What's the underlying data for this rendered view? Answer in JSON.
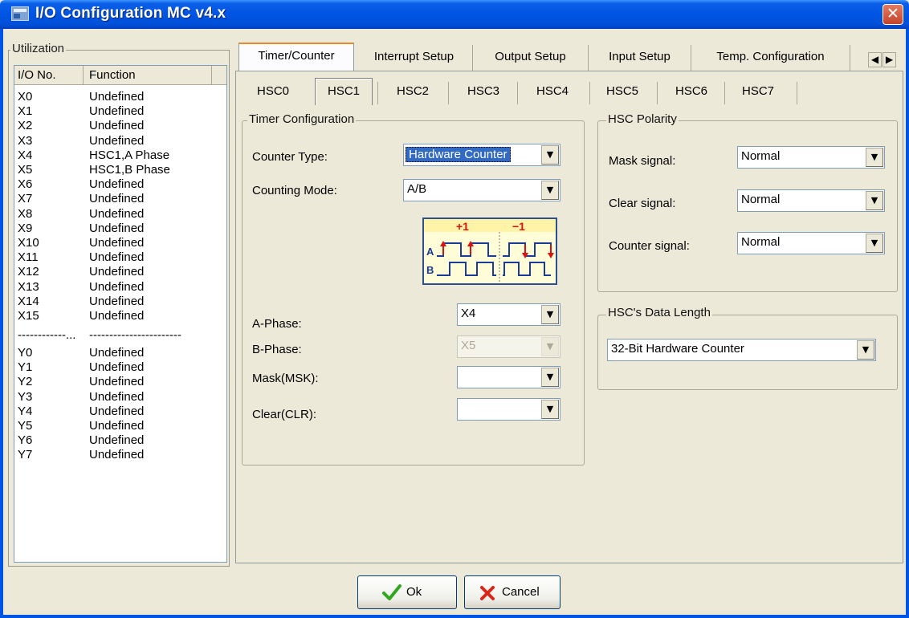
{
  "window": {
    "title": "I/O Configuration MC v4.x",
    "close_glyph": "✕"
  },
  "utilization": {
    "legend": "Utilization",
    "headers": [
      "I/O No.",
      "Function"
    ],
    "inputs": [
      {
        "io": "X0",
        "fn": "Undefined"
      },
      {
        "io": "X1",
        "fn": "Undefined"
      },
      {
        "io": "X2",
        "fn": "Undefined"
      },
      {
        "io": "X3",
        "fn": "Undefined"
      },
      {
        "io": "X4",
        "fn": "HSC1,A Phase"
      },
      {
        "io": "X5",
        "fn": "HSC1,B Phase"
      },
      {
        "io": "X6",
        "fn": "Undefined"
      },
      {
        "io": "X7",
        "fn": "Undefined"
      },
      {
        "io": "X8",
        "fn": "Undefined"
      },
      {
        "io": "X9",
        "fn": "Undefined"
      },
      {
        "io": "X10",
        "fn": "Undefined"
      },
      {
        "io": "X11",
        "fn": "Undefined"
      },
      {
        "io": "X12",
        "fn": "Undefined"
      },
      {
        "io": "X13",
        "fn": "Undefined"
      },
      {
        "io": "X14",
        "fn": "Undefined"
      },
      {
        "io": "X15",
        "fn": "Undefined"
      }
    ],
    "separator": {
      "io": "------------...",
      "fn": "-----------------------"
    },
    "outputs": [
      {
        "io": "Y0",
        "fn": "Undefined"
      },
      {
        "io": "Y1",
        "fn": "Undefined"
      },
      {
        "io": "Y2",
        "fn": "Undefined"
      },
      {
        "io": "Y3",
        "fn": "Undefined"
      },
      {
        "io": "Y4",
        "fn": "Undefined"
      },
      {
        "io": "Y5",
        "fn": "Undefined"
      },
      {
        "io": "Y6",
        "fn": "Undefined"
      },
      {
        "io": "Y7",
        "fn": "Undefined"
      }
    ]
  },
  "tabs": {
    "items": [
      "Timer/Counter",
      "Interrupt Setup",
      "Output Setup",
      "Input Setup",
      "Temp. Configuration"
    ],
    "active": "Timer/Counter",
    "scroll_left": "◀",
    "scroll_right": "▶"
  },
  "subtabs": {
    "items": [
      "HSC0",
      "HSC1",
      "HSC2",
      "HSC3",
      "HSC4",
      "HSC5",
      "HSC6",
      "HSC7"
    ],
    "active": "HSC1"
  },
  "timer_config": {
    "legend": "Timer Configuration",
    "counter_type_label": "Counter Type:",
    "counter_type_value": "Hardware Counter",
    "counting_mode_label": "Counting Mode:",
    "counting_mode_value": "A/B",
    "diagram": {
      "plus": "+1",
      "minus": "−1",
      "a": "A",
      "b": "B"
    },
    "a_phase_label": "A-Phase:",
    "a_phase_value": "X4",
    "b_phase_label": "B-Phase:",
    "b_phase_value": "X5",
    "mask_label": "Mask(MSK):",
    "mask_value": "",
    "clear_label": "Clear(CLR):",
    "clear_value": ""
  },
  "polarity": {
    "legend": "HSC Polarity",
    "mask_label": "Mask signal:",
    "mask_value": "Normal",
    "clear_label": "Clear signal:",
    "clear_value": "Normal",
    "counter_label": "Counter signal:",
    "counter_value": "Normal"
  },
  "data_length": {
    "legend": "HSC's Data Length",
    "value": "32-Bit Hardware Counter"
  },
  "buttons": {
    "ok": "Ok",
    "cancel": "Cancel"
  },
  "colors": {
    "title_blue": "#0054E3",
    "active_tab_accent": "#E68B2C",
    "selection": "#316AC5",
    "ok_check": "#2FA81F",
    "cancel_x": "#D8261A",
    "diagram_red": "#E01010",
    "diagram_blue": "#1A3C96"
  }
}
